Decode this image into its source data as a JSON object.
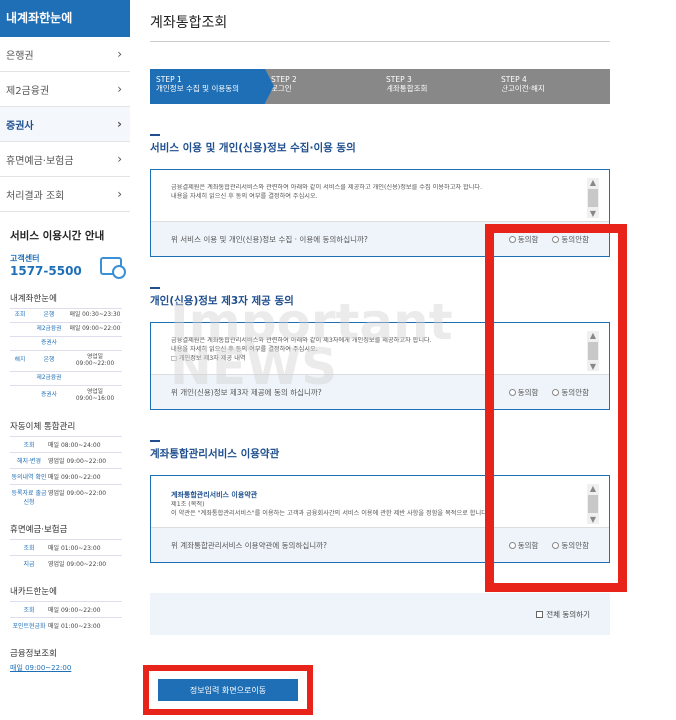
{
  "sidebar": {
    "header": "내계좌한눈에",
    "items": [
      {
        "label": "은행권",
        "active": false
      },
      {
        "label": "제2금융권",
        "active": false
      },
      {
        "label": "증권사",
        "active": true
      },
      {
        "label": "휴면예금·보험금",
        "active": false
      },
      {
        "label": "처리결과 조회",
        "active": false
      }
    ],
    "hours": {
      "title": "서비스 이용시간 안내",
      "cc_label": "고객센터",
      "cc_number": "1577-5500",
      "section1": "내계좌한눈에",
      "rows1": [
        {
          "cat": "조회",
          "label": "은행",
          "time": "매일 00:30~23:30"
        },
        {
          "cat": "",
          "label": "제2금융권",
          "time": "매일 09:00~22:00"
        },
        {
          "cat": "",
          "label": "증권사",
          "time": ""
        },
        {
          "cat": "해지",
          "label": "은행",
          "time": "영업일 09:00~22:00"
        },
        {
          "cat": "",
          "label": "제2금융권",
          "time": ""
        },
        {
          "cat": "",
          "label": "증권사",
          "time": "영업일 09:00~16:00"
        }
      ],
      "section2": "자동이체 통합관리",
      "rows2": [
        {
          "k": "조회",
          "v": "매일 08:00~24:00"
        },
        {
          "k": "해지·변경",
          "v": "영업일 09:00~22:00"
        },
        {
          "k": "동의내역 확인",
          "v": "매일 09:00~22:00"
        },
        {
          "k": "등록자료 출금신청",
          "v": "영업일 09:00~22:00"
        }
      ],
      "section3": "휴면예금·보험금",
      "rows3": [
        {
          "k": "조회",
          "v": "매일 01:00~23:00"
        },
        {
          "k": "지급",
          "v": "영업일 09:00~22:00"
        }
      ],
      "section4": "내카드한눈에",
      "rows4": [
        {
          "k": "조회",
          "v": "매일 09:00~22:00"
        },
        {
          "k": "포인트현금화",
          "v": "매일 01:00~23:00"
        }
      ],
      "section5": "금융정보조회",
      "section5_time": "매일 09:00~22:00"
    }
  },
  "main": {
    "title": "계좌통합조회",
    "steps": [
      {
        "num": "STEP 1",
        "label": "개인정보 수집 및 이용동의",
        "active": true
      },
      {
        "num": "STEP 2",
        "label": "로그인",
        "active": false
      },
      {
        "num": "STEP 3",
        "label": "계좌통합조회",
        "active": false
      },
      {
        "num": "STEP 4",
        "label": "잔고이전·해지",
        "active": false
      }
    ],
    "sections": [
      {
        "heading": "서비스 이용 및 개인(신용)정보 수집·이용 동의",
        "terms_title": "",
        "terms": "금융결제원은 계좌통합관리서비스와 관련하여 아래와 같이 서비스를 제공하고 개인(신용)정보를 수집 이용하고자 합니다.\n내용을 자세히 읽으신 후 동의 여부를 결정하여 주십시오.",
        "question": "위 서비스 이용 및 개인(신용)정보 수집 · 이용에 동의하십니까?",
        "agree": "동의함",
        "disagree": "동의안함"
      },
      {
        "heading": "개인(신용)정보 제3자 제공 동의",
        "terms_title": "",
        "terms": "금융결제원은 계좌통합관리서비스와 관련하여 아래와 같이 제3자에게 개인정보를 제공하고자 합니다.\n내용을 자세히 읽으신 후 동의 여부를 결정하여 주십시오.\n□ 개인정보 제3자 제공 내역",
        "question": "위 개인(신용)정보 제3자 제공에 동의 하십니까?",
        "agree": "동의함",
        "disagree": "동의안함"
      },
      {
        "heading": "계좌통합관리서비스 이용약관",
        "terms_title": "계좌통합관리서비스 이용약관",
        "terms": "제1조 (목적)\n이 약관은 \"계좌통합관리서비스\"를 이용하는 고객과 금융회사간의 서비스 이용에 관한 제반 사항을 정함을 목적으로 합니다.",
        "question": "위 계좌통합관리서비스 이용약관에 동의하십니까?",
        "agree": "동의함",
        "disagree": "동의안함"
      }
    ],
    "all_agree": "전체 동의하기",
    "submit": "정보입력 화면으로이동"
  },
  "watermark": "Important\nNEWS",
  "colors": {
    "primary": "#1f6fb7",
    "highlight": "#e8231a",
    "step_inactive": "#888888"
  }
}
